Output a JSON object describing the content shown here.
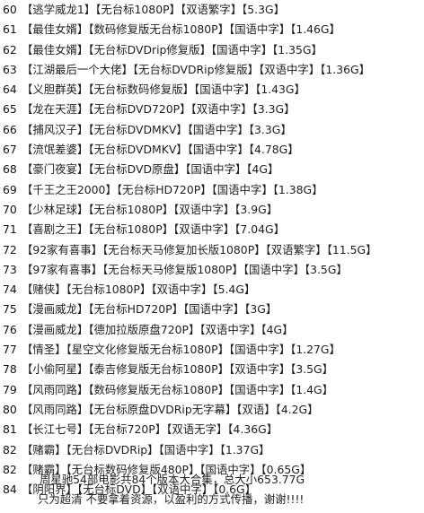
{
  "entries": [
    {
      "num": "60",
      "text": "【逃学威龙1】【无台标1080P】【双语繁字】【5.3G】"
    },
    {
      "num": "61",
      "text": "【最佳女婿】【数码修复版无台标1080P】【国语中字】【1.46G】"
    },
    {
      "num": "62",
      "text": "【最佳女婿】【无台标DVDrip修复版】【国语中字】【1.35G】"
    },
    {
      "num": "63",
      "text": "【江湖最后一个大佬】【无台标DVDRip修复版】【双语中字】【1.36G】"
    },
    {
      "num": "64",
      "text": "【义胆群英】【无台标数码修复版】【国语中字】【1.43G】"
    },
    {
      "num": "65",
      "text": "【龙在天涯】【无台标DVD720P】【双语中字】【3.3G】"
    },
    {
      "num": "66",
      "text": "【捕风汉子】【无台标DVDMKV】【国语中字】【3.3G】"
    },
    {
      "num": "67",
      "text": "【流氓差婆】【无台标DVDMKV】【国语中字】【4.78G】"
    },
    {
      "num": "68",
      "text": "【豪门夜宴】【无台标DVD原盘】【国语中字】【4G】"
    },
    {
      "num": "69",
      "text": "【千王之王2000】【无台标HD720P】【国语中字】【1.38G】"
    },
    {
      "num": "70",
      "text": "【少林足球】【无台标1080P】【双语中字】【3.9G】"
    },
    {
      "num": "71",
      "text": "【喜剧之王】【无台标1080P】【双语中字】【7.04G】"
    },
    {
      "num": "72",
      "text": "【92家有喜事】【无台标天马修复加长版1080P】【双语繁字】【11.5G】"
    },
    {
      "num": "73",
      "text": "【97家有喜事】【无台标天马修复版1080P】【国语中字】【3.5G】"
    },
    {
      "num": "74",
      "text": "【赌侠】【无台标1080P】【双语中字】【5.4G】"
    },
    {
      "num": "75",
      "text": "【漫画威龙】【无台标HD720P】【国语中字】【3G】"
    },
    {
      "num": "76",
      "text": "【漫画威龙】【德加拉版原盘720P】【双语中字】【4G】"
    },
    {
      "num": "77",
      "text": "【情圣】【星空文化修复版无台标1080P】【国语中字】【1.27G】"
    },
    {
      "num": "78",
      "text": "【小偷阿星】【泰吉修复版无台标1080P】【双语中字】【3.5G】"
    },
    {
      "num": "79",
      "text": "【风雨同路】【数码修复版无台标1080P】【国语中字】【1.4G】"
    },
    {
      "num": "80",
      "text": "【风雨同路】【无台标原盘DVDRip无字幕】【双语】【4.2G】"
    },
    {
      "num": "81",
      "text": "【长江七号】【无台标720P】【双语无字】【4.36G】"
    },
    {
      "num": "82",
      "text": "【赌霸】【无台标DVDRip】【国语中字】【1.37G】"
    },
    {
      "num": "82",
      "text": "【赌霸】【无台标数码修复版480P】【国语中字】【0.65G】"
    },
    {
      "num": "84",
      "text": "【阴阳界】【无台标DVD】【双语中字】【0.6G】"
    }
  ],
  "footer": {
    "summary": "周星驰54部电影共84个版本大合集，总大小653.77G",
    "slogan": "只为超清 不要拿着资源，以盈利的方式传播，谢谢!!!!"
  }
}
